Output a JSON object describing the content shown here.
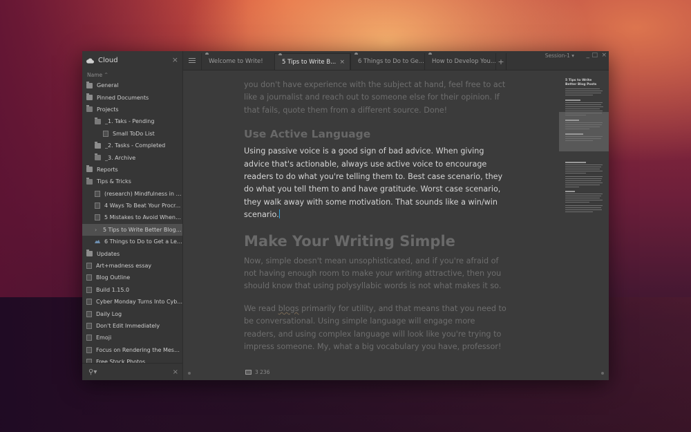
{
  "sidebar": {
    "title": "Cloud",
    "cloud_icon": "cloud-icon",
    "sort_label": "Name",
    "sort_direction_icon": "chevron-up-icon",
    "items": [
      {
        "label": "General",
        "type": "folder",
        "depth": 0
      },
      {
        "label": "Pinned Documents",
        "type": "folder",
        "depth": 0
      },
      {
        "label": "Projects",
        "type": "folder-open",
        "depth": 0
      },
      {
        "label": "_1. Taks - Pending",
        "type": "folder-open",
        "depth": 1
      },
      {
        "label": "Small ToDo List",
        "type": "document",
        "depth": 2
      },
      {
        "label": "_2. Tasks - Completed",
        "type": "folder",
        "depth": 1
      },
      {
        "label": "_3. Archive",
        "type": "folder-open",
        "depth": 1
      },
      {
        "label": "Reports",
        "type": "folder",
        "depth": 0
      },
      {
        "label": "Tips & Tricks",
        "type": "folder-open",
        "depth": 0
      },
      {
        "label": "(research) Mindfulness in Si...",
        "type": "document",
        "depth": 1
      },
      {
        "label": "4 Ways To Beat Your Procr...",
        "type": "document",
        "depth": 1
      },
      {
        "label": "5 Mistakes to Avoid When ...",
        "type": "document",
        "depth": 1
      },
      {
        "label": "5 Tips to Write Better Blog ...",
        "type": "active",
        "depth": 1
      },
      {
        "label": "6 Things to Do to Get a Leg ...",
        "type": "cloud",
        "depth": 1
      },
      {
        "label": "Updates",
        "type": "folder",
        "depth": 0
      },
      {
        "label": "Art+madness essay",
        "type": "document",
        "depth": 0
      },
      {
        "label": "Blog Outline",
        "type": "document",
        "depth": 0
      },
      {
        "label": "Build 1.15.0",
        "type": "document",
        "depth": 0
      },
      {
        "label": "Cyber Monday Turns Into Cyb...",
        "type": "document",
        "depth": 0
      },
      {
        "label": "Daily Log",
        "type": "document",
        "depth": 0
      },
      {
        "label": "Don't Edit Immediately",
        "type": "document",
        "depth": 0
      },
      {
        "label": "Emoji",
        "type": "document",
        "depth": 0
      },
      {
        "label": "Focus on Rendering the Messa...",
        "type": "document",
        "depth": 0
      },
      {
        "label": "Free Stock Photos",
        "type": "document",
        "depth": 0
      }
    ],
    "search": {
      "value": "",
      "placeholder": ""
    }
  },
  "tabs": [
    {
      "label": "Welcome to Write!",
      "active": false
    },
    {
      "label": "5 Tips to Write B...",
      "active": true
    },
    {
      "label": "6 Things to Do to Ge...",
      "active": false
    },
    {
      "label": "How to Develop You...",
      "active": false
    }
  ],
  "toolbar": {
    "add_tab": "+",
    "session": "Session-1",
    "minimize": "_",
    "maximize": "□",
    "close": "×"
  },
  "document": {
    "para_top": "you don't have experience with the subject at hand, feel free to act like a journalist and reach out to someone else for their opinion. If that fails, quote them from a different source. Done!",
    "heading_active": "Use Active Language",
    "para_active": "Using passive voice is a good sign of bad advice. When giving advice that's actionable, always use active voice to encourage readers to do what you're telling them to. Best case scenario, they do what you tell them to and have gratitude. Worst case scenario, they walk away with some motivation. That sounds like a win/win scenario.",
    "heading_simple": "Make Your Writing Simple",
    "para_simple_1": "Now, simple doesn't mean unsophisticated, and if you're afraid of not having enough room to make your writing attractive, then you should know that using polysyllabic words is not what makes it so.",
    "para_simple_2_pre": "We read ",
    "para_simple_2_word": "blogs",
    "para_simple_2_post": " primarily for utility, and that means that you need to be conversational. Using simple language will engage more readers, and using complex language will look like you're trying to impress someone. My, what a big vocabulary you have, professor!"
  },
  "status": {
    "word_count": "3 236"
  },
  "minimap": {
    "title": "5 Tips to Write Better Blog Posts"
  }
}
